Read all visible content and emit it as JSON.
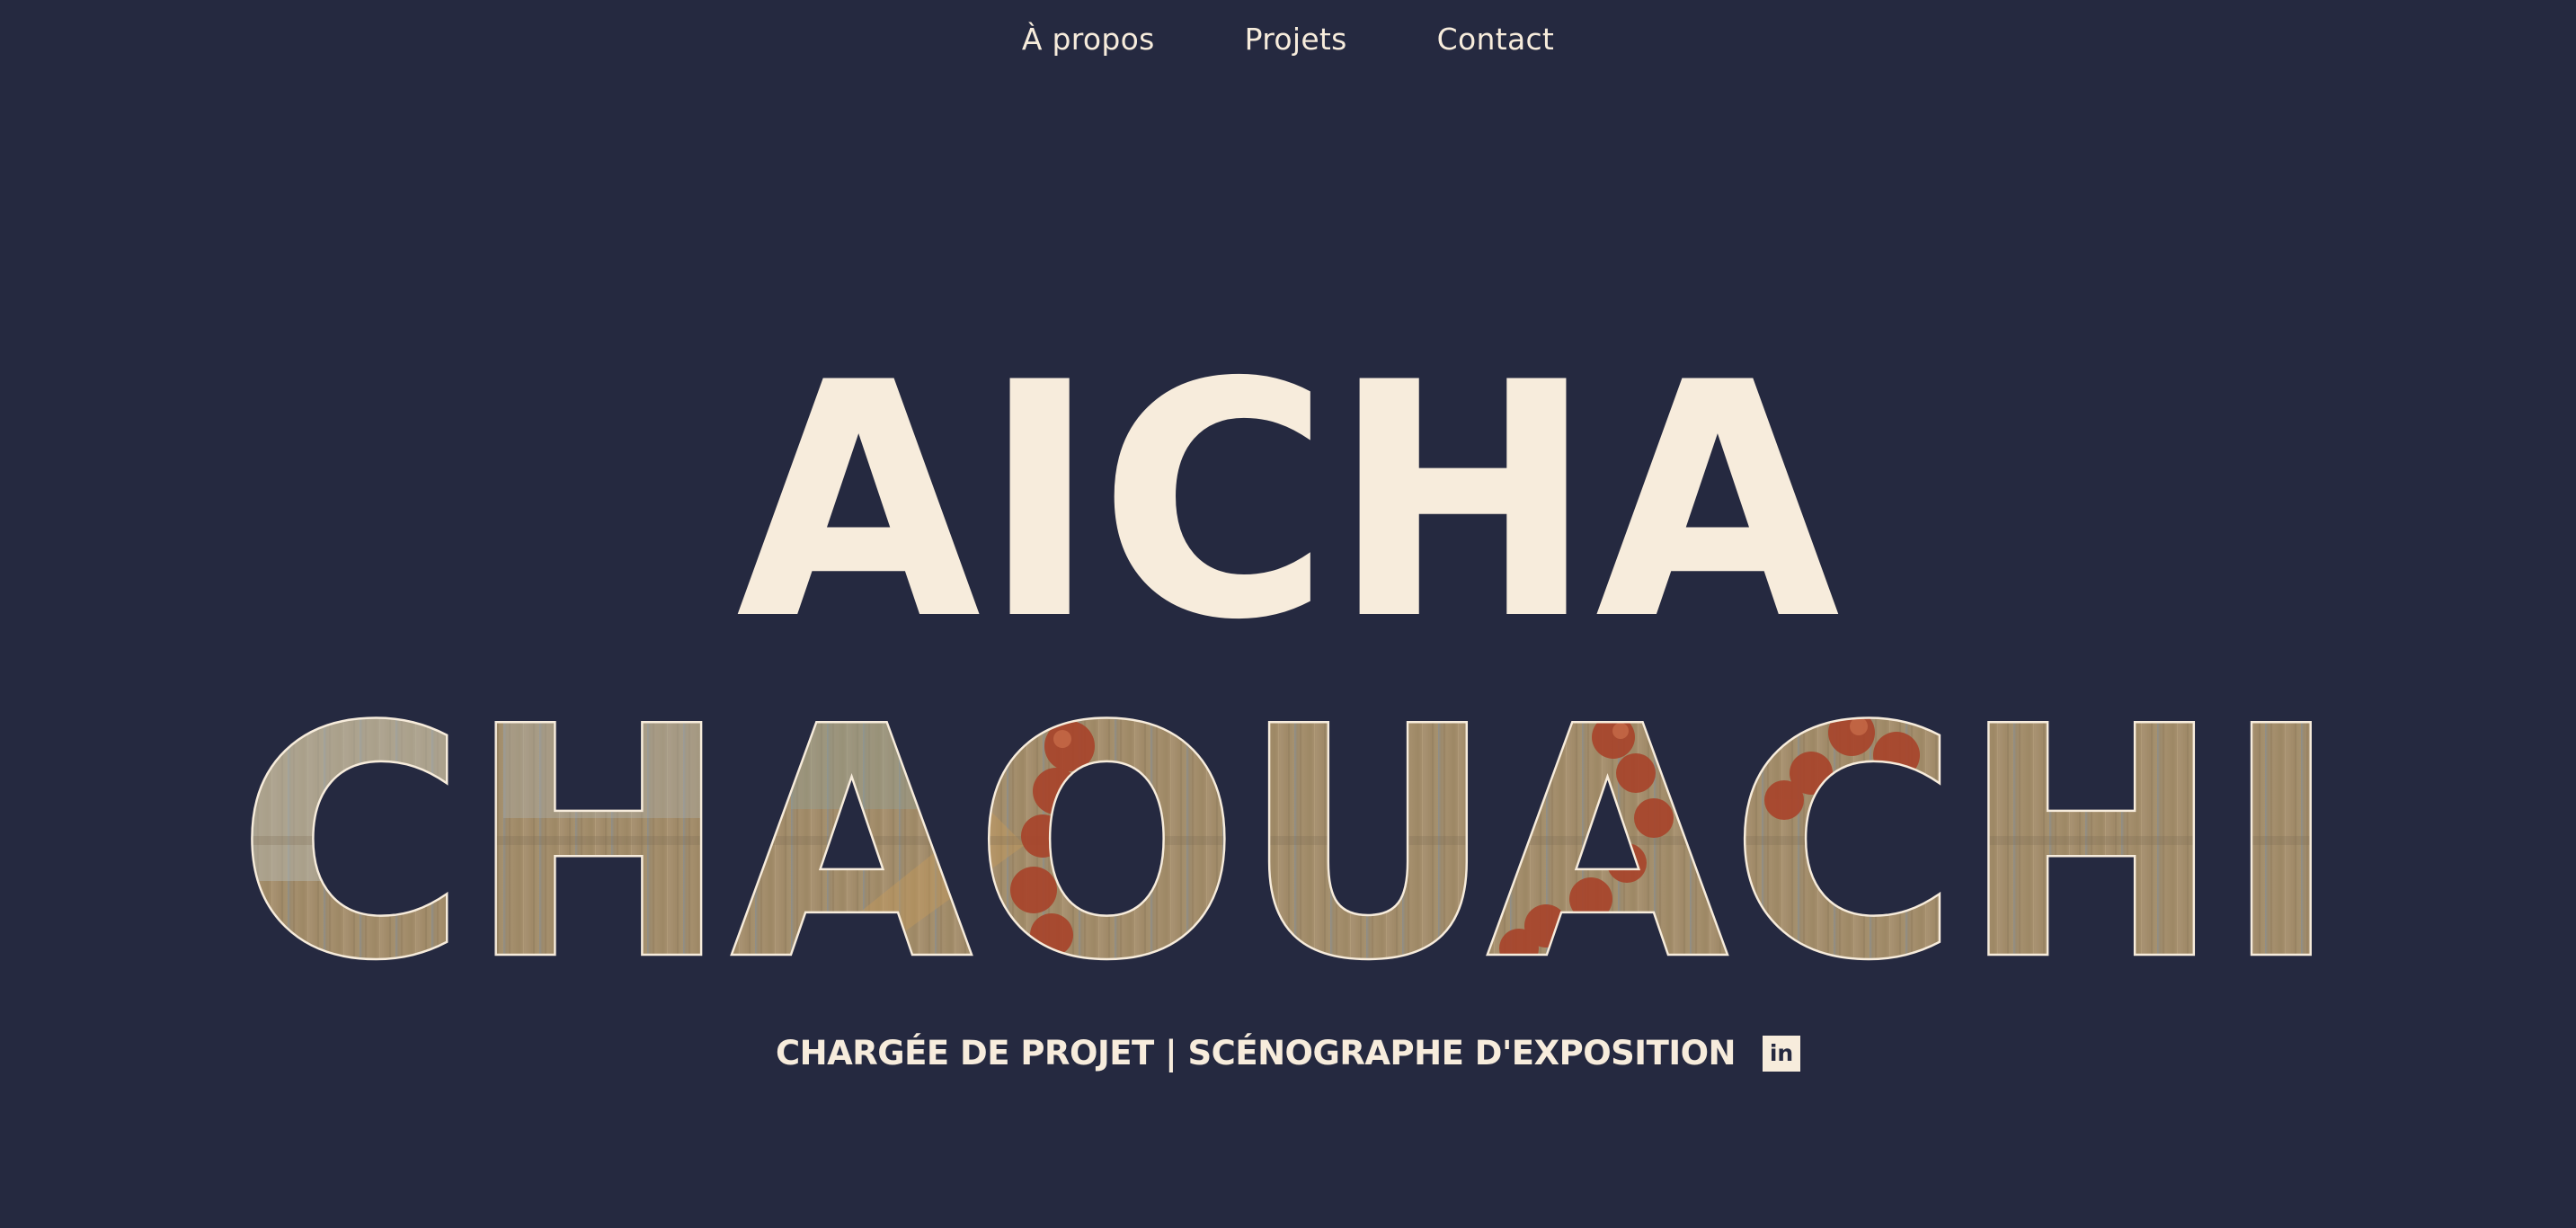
{
  "nav": {
    "items": [
      {
        "label": "À propos"
      },
      {
        "label": "Projets"
      },
      {
        "label": "Contact"
      }
    ]
  },
  "hero": {
    "first_name": "AICHA",
    "last_name": "CHAOUACHI",
    "subtitle": "CHARGÉE DE PROJET | SCÉNOGRAPHE D'EXPOSITION",
    "social_icon": "linkedin-icon",
    "social_icon_text": "in"
  },
  "colors": {
    "background": "#252940",
    "text": "#f7ecdc",
    "photo_wood": "#a89271",
    "photo_accent": "#a8432a"
  }
}
